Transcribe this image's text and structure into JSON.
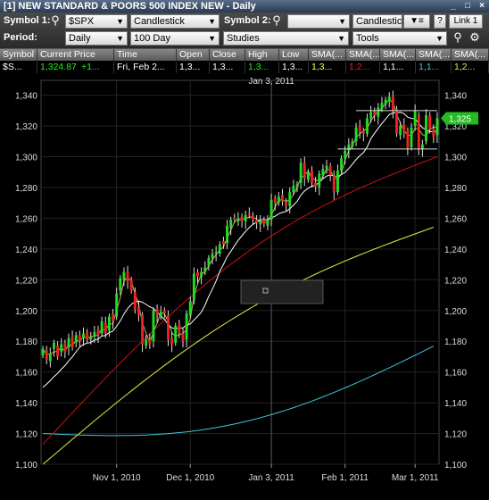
{
  "window": {
    "title": "[1] NEW STANDARD & POORS 500 INDEX NEW - Daily",
    "buttons": [
      "_",
      "□",
      "×"
    ]
  },
  "toolbar": {
    "symbol1_label": "Symbol 1:",
    "symbol1_value": "$SPX",
    "chart_type": "Candlestick",
    "symbol2_label": "Symbol 2:",
    "symbol2_value": "",
    "chart_type2": "Candlestic",
    "help": "?",
    "link": "Link 1",
    "period_label": "Period:",
    "period": "Daily",
    "range": "100 Day",
    "studies": "Studies",
    "tools": "Tools"
  },
  "quote_table": {
    "headers": [
      "Symbol",
      "Current Price",
      "Time",
      "Open",
      "Close",
      "High",
      "Low",
      "SMA(...",
      "SMA(...",
      "SMA(...",
      "SMA(...",
      "SMA(..."
    ],
    "row": [
      "$S...",
      "1,324.87",
      "+1...",
      "Fri, Feb 2...",
      "1,3...",
      "1,3...",
      "1,3...",
      "1,3...",
      "1,3...",
      "1,2...",
      "1,1...",
      "1,1...",
      "1,2..."
    ]
  },
  "colors": {
    "up": "#22dd22",
    "down": "#ee2222",
    "sma_short": "#e8e080",
    "sma_white": "#ffffff",
    "sma_red": "#cc1111",
    "sma_yellow": "#e8e840",
    "sma_cyan": "#40c8e0",
    "price_badge": "#22bb22"
  },
  "chart_data": {
    "type": "candlestick",
    "crosshair_label": "Jan 3, 2011",
    "price_badge": "1,325",
    "ylim": [
      1100,
      1345
    ],
    "yticks": [
      1100,
      1120,
      1140,
      1160,
      1180,
      1200,
      1220,
      1240,
      1260,
      1280,
      1300,
      1320,
      1340
    ],
    "ytick_labels": [
      "1,100",
      "1,120",
      "1,140",
      "1,160",
      "1,180",
      "1,200",
      "1,220",
      "1,240",
      "1,260",
      "1,280",
      "1,300",
      "1,320",
      "1,340"
    ],
    "xtick_labels": [
      "Nov 1, 2010",
      "Dec 1, 2010",
      "Jan 3, 2011",
      "Feb 1, 2011",
      "Mar 1, 2011"
    ],
    "xtick_index": [
      20,
      40,
      62,
      82,
      101
    ],
    "bar_count": 108,
    "closes": [
      1175,
      1168,
      1172,
      1179,
      1170,
      1178,
      1173,
      1182,
      1176,
      1184,
      1180,
      1185,
      1181,
      1183,
      1186,
      1184,
      1193,
      1185,
      1196,
      1193,
      1211,
      1221,
      1225,
      1219,
      1213,
      1201,
      1197,
      1178,
      1181,
      1178,
      1200,
      1197,
      1199,
      1198,
      1181,
      1178,
      1190,
      1185,
      1180,
      1198,
      1206,
      1224,
      1222,
      1225,
      1228,
      1234,
      1237,
      1238,
      1243,
      1243,
      1255,
      1259,
      1259,
      1260,
      1258,
      1262,
      1262,
      1259,
      1257,
      1258,
      1256,
      1259,
      1272,
      1270,
      1274,
      1271,
      1268,
      1277,
      1281,
      1282,
      1296,
      1286,
      1290,
      1283,
      1281,
      1289,
      1292,
      1294,
      1288,
      1277,
      1291,
      1299,
      1304,
      1308,
      1310,
      1319,
      1316,
      1315,
      1325,
      1329,
      1327,
      1332,
      1335,
      1337,
      1339,
      1330,
      1315,
      1320,
      1316,
      1306,
      1319,
      1330,
      1305,
      1308,
      1327,
      1318,
      1313,
      1325
    ],
    "open_offsets": [
      -4,
      6,
      -5,
      -4,
      7,
      -5,
      6,
      -6,
      7,
      -5,
      4,
      -3,
      5,
      -2,
      -3,
      4,
      -8,
      7,
      -9,
      5,
      -15,
      -8,
      -5,
      6,
      7,
      11,
      5,
      19,
      -4,
      3,
      -20,
      4,
      -3,
      2,
      16,
      4,
      -11,
      6,
      5,
      -17,
      -9,
      -17,
      3,
      -3,
      -3,
      -5,
      -3,
      -1,
      -6,
      2,
      -11,
      -5,
      1,
      -2,
      3,
      -4,
      1,
      3,
      2,
      -2,
      3,
      -4,
      -13,
      3,
      -4,
      4,
      3,
      -9,
      -4,
      -2,
      -13,
      10,
      -5,
      8,
      2,
      -9,
      -4,
      -2,
      6,
      11,
      -14,
      -8,
      -5,
      -4,
      -3,
      -9,
      4,
      2,
      -10,
      -4,
      3,
      -6,
      -4,
      -3,
      -3,
      9,
      16,
      -6,
      5,
      11,
      -13,
      -10,
      22,
      -3,
      -17,
      9,
      5,
      -11
    ],
    "sma_white_ends": [
      [
        0,
        1150
      ],
      [
        107,
        1322
      ]
    ],
    "sma_red_ends": [
      [
        0,
        1113
      ],
      [
        107,
        1300
      ]
    ],
    "sma_yellow_ends": [
      [
        0,
        1100
      ],
      [
        107,
        1255
      ]
    ],
    "sma_cyan_ends": [
      [
        0,
        1120
      ],
      [
        107,
        1178
      ]
    ],
    "resistance_line": 1330,
    "support_line": 1305
  }
}
